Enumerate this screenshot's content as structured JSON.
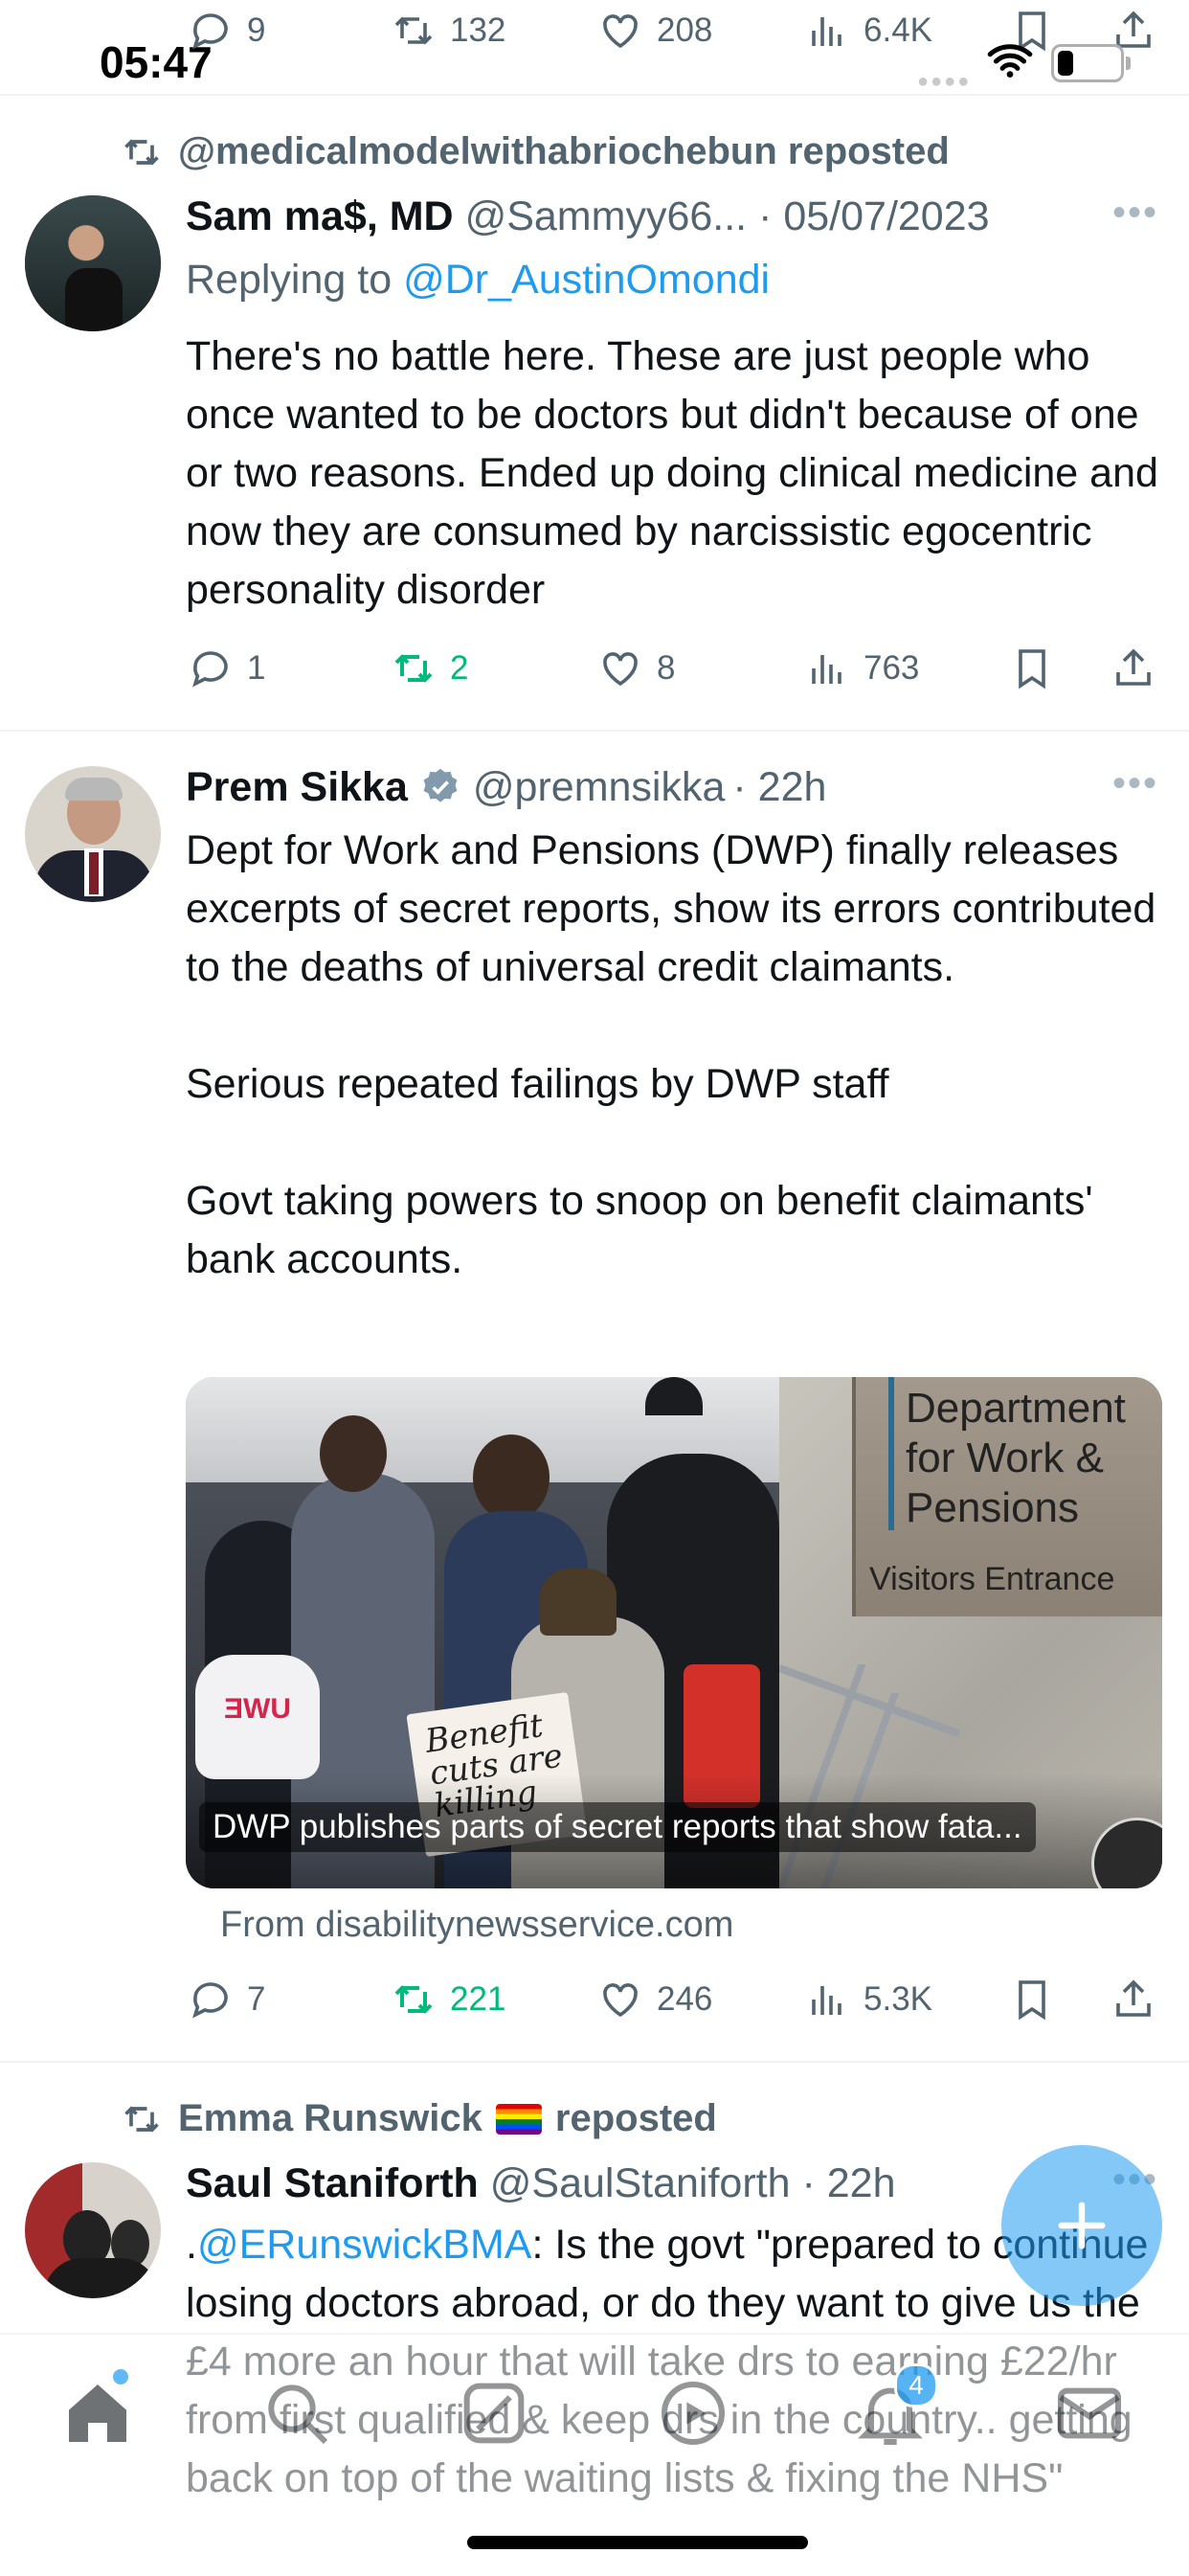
{
  "status_bar": {
    "time": "05:47"
  },
  "top_partial_actions": {
    "replies": "9",
    "reposts": "132",
    "likes": "208",
    "views": "6.4K"
  },
  "tweets": [
    {
      "repost_label": "@medicalmodelwithabriochebun reposted",
      "name": "Sam ma$, MD",
      "handle": "@Sammyy66...",
      "time": "· 05/07/2023",
      "reply_prefix": "Replying to ",
      "reply_to": "@Dr_AustinOmondi",
      "text": "There's no battle here. These are just people who once wanted to be doctors but didn't because of one or two reasons. Ended up doing clinical medicine and now they are consumed by narcissistic egocentric personality disorder",
      "replies": "1",
      "reposts": "2",
      "likes": "8",
      "views": "763"
    },
    {
      "name": "Prem Sikka",
      "handle": "@premnsikka",
      "time": "· 22h",
      "text": "Dept for Work and Pensions (DWP) finally releases excerpts of secret reports, show its errors contributed to the deaths of universal credit claimants.\n\nSerious repeated failings by DWP staff\n\nGovt taking powers to snoop on benefit claimants' bank accounts.",
      "card": {
        "sign_line1": "Department",
        "sign_line2": "for Work &",
        "sign_line3": "Pensions",
        "sign_sub": "Visitors Entrance",
        "placard": "Benefit cuts are killing",
        "bag_logo": "ƎWU",
        "caption": "DWP publishes parts of secret reports that show fata...",
        "source": "From disabilitynewsservice.com"
      },
      "replies": "7",
      "reposts": "221",
      "likes": "246",
      "views": "5.3K"
    },
    {
      "repost_label": "Emma Runswick",
      "repost_suffix": "reposted",
      "name": "Saul Staniforth",
      "handle": "@SaulStaniforth",
      "time": "· 22h",
      "mention_prefix": ".",
      "mention": "@ERunswickBMA",
      "text": ": Is the govt \"prepared to continue losing doctors abroad, or do they want to give us the £4 more an hour that will take drs to earning £22/hr from first qualified & keep drs in the country.. getting back on top of the waiting lists & fixing the NHS\""
    }
  ],
  "bottom_nav": {
    "notifications_count": "4"
  },
  "colors": {
    "accent": "#1d9bf0",
    "repost_green": "#00ba7c",
    "text": "#0f1419",
    "muted": "#536471"
  }
}
